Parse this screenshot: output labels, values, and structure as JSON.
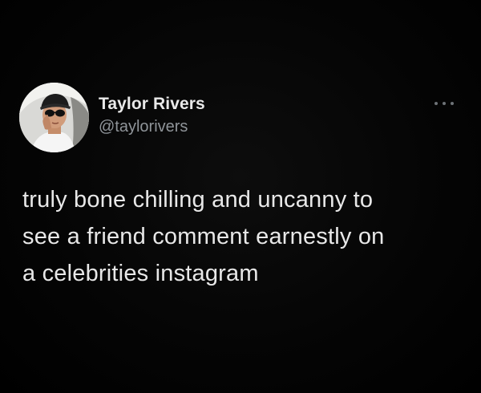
{
  "author": {
    "display_name": "Taylor Rivers",
    "handle": "@taylorivers",
    "avatar_icon": "user-avatar-photo"
  },
  "menu": {
    "icon": "more-horizontal-icon"
  },
  "tweet": {
    "lines": [
      "truly bone chilling and uncanny to",
      "see a friend comment earnestly on",
      "a celebrities instagram"
    ]
  },
  "colors": {
    "background": "#000000",
    "text_primary": "#e8e8e8",
    "text_secondary": "#8f9499"
  }
}
